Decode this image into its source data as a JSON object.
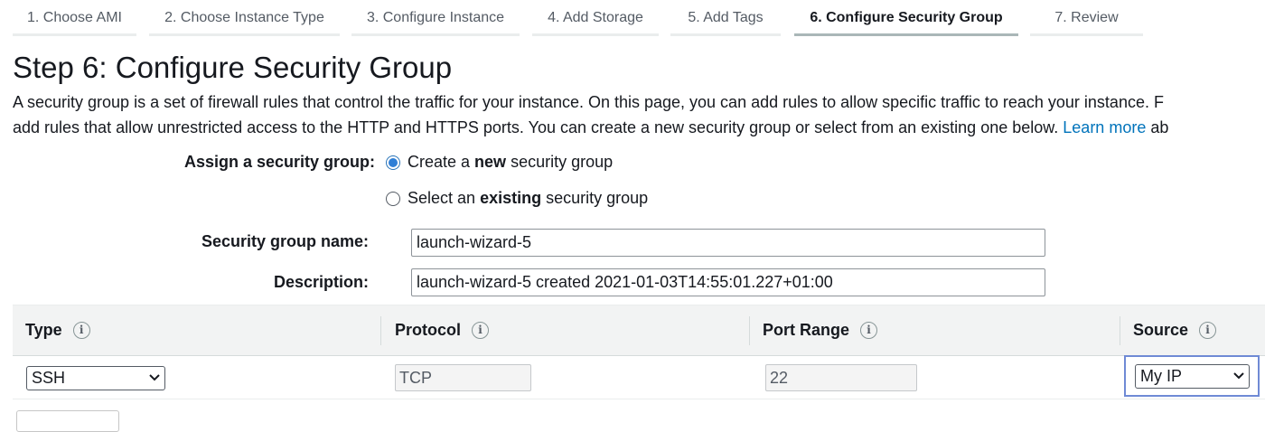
{
  "wizard": {
    "tabs": [
      {
        "label": "1. Choose AMI"
      },
      {
        "label": "2. Choose Instance Type"
      },
      {
        "label": "3. Configure Instance"
      },
      {
        "label": "4. Add Storage"
      },
      {
        "label": "5. Add Tags"
      },
      {
        "label": "6. Configure Security Group",
        "active": true
      },
      {
        "label": "7. Review"
      }
    ]
  },
  "page": {
    "title": "Step 6: Configure Security Group",
    "intro_line1": "A security group is a set of firewall rules that control the traffic for your instance. On this page, you can add rules to allow specific traffic to reach your instance. F",
    "intro_line2": "add rules that allow unrestricted access to the HTTP and HTTPS ports. You can create a new security group or select from an existing one below.",
    "learn_more": "Learn more",
    "intro_tail": "ab"
  },
  "assign": {
    "label": "Assign a security group:",
    "option_new": {
      "prefix": "Create a ",
      "bold": "new",
      "suffix": " security group",
      "checked": true
    },
    "option_existing": {
      "prefix": "Select an ",
      "bold": "existing",
      "suffix": " security group",
      "checked": false
    }
  },
  "form": {
    "name_label": "Security group name:",
    "name_value": "launch-wizard-5",
    "description_label": "Description:",
    "description_value": "launch-wizard-5 created 2021-01-03T14:55:01.227+01:00"
  },
  "rules_table": {
    "columns": [
      "Type",
      "Protocol",
      "Port Range",
      "Source"
    ],
    "info_glyph": "i",
    "rows": [
      {
        "type": "SSH",
        "protocol": "TCP",
        "port_range": "22",
        "source": "My IP"
      }
    ]
  },
  "icons": {
    "info": "info-icon",
    "chevron": "chevron-down-icon"
  },
  "colors": {
    "link": "#0073bb",
    "radio_selected": "#2f7fd6",
    "focus_ring": "#6f8ad5",
    "header_bg": "#f2f3f3"
  }
}
